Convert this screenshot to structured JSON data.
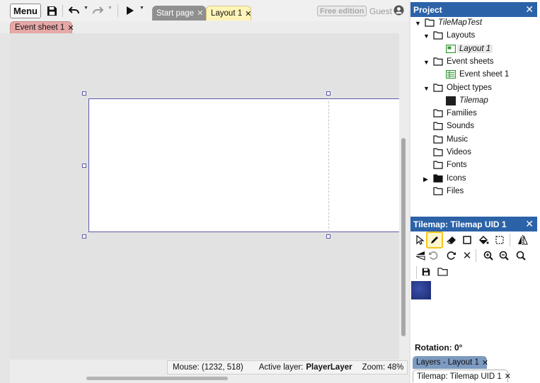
{
  "toolbar": {
    "menu_label": "Menu",
    "icons": [
      "save-icon",
      "undo-icon",
      "redo-icon",
      "play-icon"
    ]
  },
  "tabs": [
    {
      "label": "Start page",
      "active": false
    },
    {
      "label": "Layout 1",
      "active": true
    }
  ],
  "sub_tabs": [
    {
      "label": "Event sheet 1"
    }
  ],
  "free_edition": "Free edition",
  "user": {
    "label": "Guest"
  },
  "status": {
    "mouse": "Mouse: (1232, 518)",
    "active_layer_label": "Active layer:",
    "active_layer_value": "PlayerLayer",
    "zoom": "Zoom: 48%"
  },
  "project": {
    "title": "Project",
    "tree": [
      {
        "label": "TileMapTest",
        "depth": 0,
        "expanded": true,
        "icon": "folder-icon",
        "italic": true
      },
      {
        "label": "Layouts",
        "depth": 1,
        "expanded": true,
        "icon": "folder-icon"
      },
      {
        "label": "Layout 1",
        "depth": 2,
        "icon": "layout-icon",
        "italic": true,
        "selected": true
      },
      {
        "label": "Event sheets",
        "depth": 1,
        "expanded": true,
        "icon": "folder-icon"
      },
      {
        "label": "Event sheet 1",
        "depth": 2,
        "icon": "event-sheet-icon"
      },
      {
        "label": "Object types",
        "depth": 1,
        "expanded": true,
        "icon": "folder-icon"
      },
      {
        "label": "Tilemap",
        "depth": 2,
        "icon": "tilemap-icon",
        "italic": true
      },
      {
        "label": "Families",
        "depth": 1,
        "icon": "folder-icon"
      },
      {
        "label": "Sounds",
        "depth": 1,
        "icon": "folder-icon"
      },
      {
        "label": "Music",
        "depth": 1,
        "icon": "folder-icon"
      },
      {
        "label": "Videos",
        "depth": 1,
        "icon": "folder-icon"
      },
      {
        "label": "Fonts",
        "depth": 1,
        "icon": "folder-icon"
      },
      {
        "label": "Icons",
        "depth": 1,
        "expanded": false,
        "icon": "folder-filled-icon"
      },
      {
        "label": "Files",
        "depth": 1,
        "icon": "folder-icon"
      }
    ]
  },
  "tilemap_panel": {
    "title": "Tilemap: Tilemap UID 1",
    "tools": [
      "pointer-icon",
      "pencil-icon",
      "eraser-icon",
      "rectangle-icon",
      "fill-icon",
      "select-area-icon",
      "flip-horizontal-icon",
      "flip-vertical-icon",
      "rotate-ccw-icon",
      "rotate-cw-icon",
      "clear-icon",
      "zoom-in-icon",
      "zoom-reset-icon",
      "zoom-out-icon",
      "save-icon",
      "folder-icon"
    ]
  },
  "properties": {
    "rotation": "Rotation: 0°"
  },
  "bottom_tabs": [
    {
      "label": "Layers - Layout 1"
    },
    {
      "label": "Tilemap: Tilemap UID 1"
    }
  ],
  "colors": {
    "panel_header": "#2c63a8",
    "layout_tab": "#fff4b8",
    "event_tab": "#e7a8a8",
    "accent": "#f5c518"
  }
}
